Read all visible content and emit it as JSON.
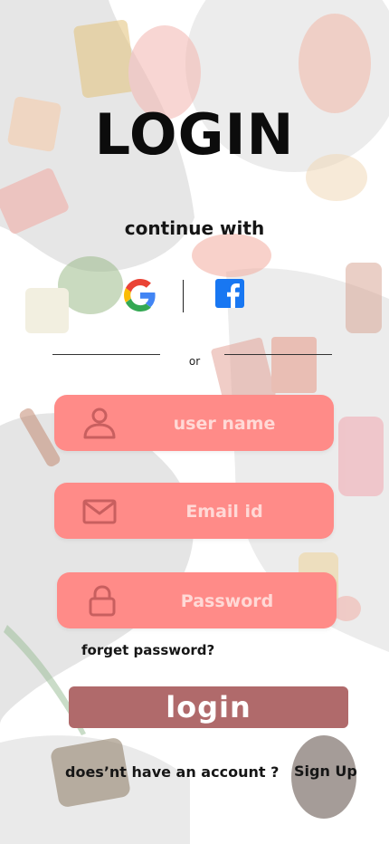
{
  "title": "LOGIN",
  "continue_text": "continue with",
  "social": {
    "google_icon": "google-g-icon",
    "facebook_icon": "facebook-f-icon",
    "or_text": "or"
  },
  "form": {
    "username_placeholder": "user name",
    "email_placeholder": "Email id",
    "password_placeholder": "Password",
    "forgot_label": "forget password?",
    "login_label": "login",
    "no_account_text": "does’nt have an account ?",
    "signup_label": "Sign Up"
  },
  "colors": {
    "field": "#ff8b88",
    "field_icon": "#c85f5f",
    "login_button": "#b06a6b",
    "text": "#0c0c0c",
    "google_blue": "#4285F4",
    "google_red": "#EA4335",
    "google_yellow": "#FBBC05",
    "google_green": "#34A853",
    "facebook_blue": "#1877F2"
  }
}
